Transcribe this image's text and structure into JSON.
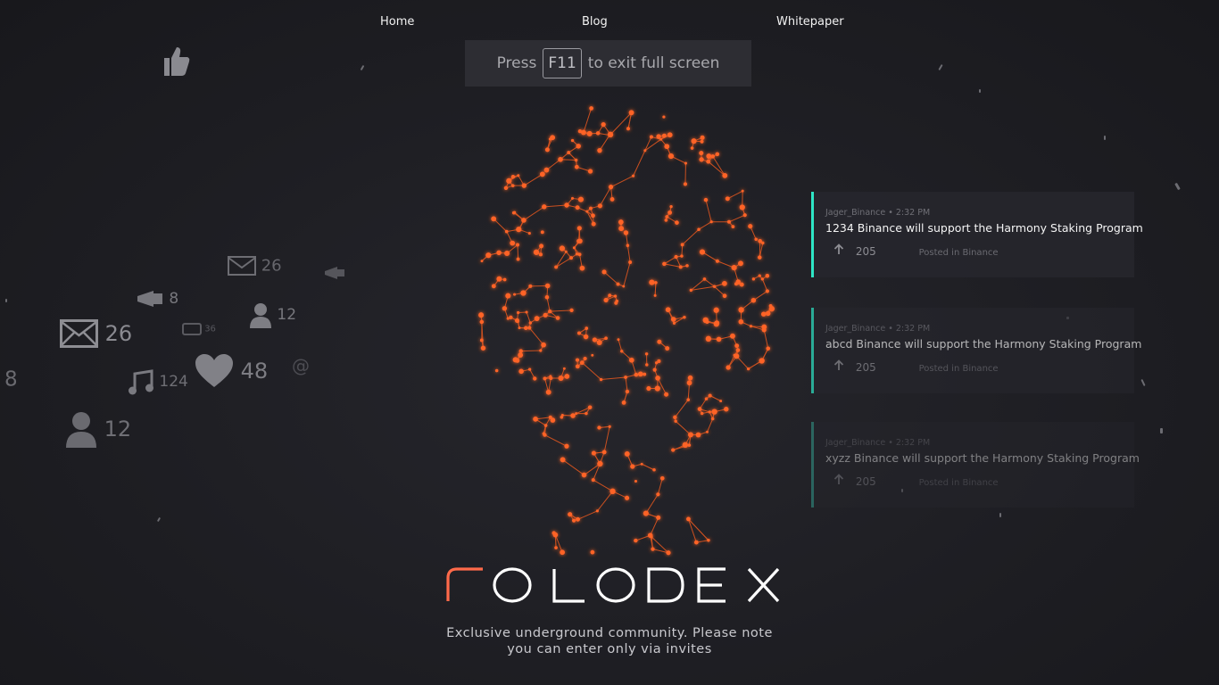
{
  "nav": {
    "home": "Home",
    "blog": "Blog",
    "whitepaper": "Whitepaper"
  },
  "fullscreen_notice": {
    "before": "Press",
    "key": "F11",
    "after": "to exit full screen"
  },
  "social_icons": [
    {
      "icon": "mail-icon",
      "count": "26"
    },
    {
      "icon": "megaphone-icon",
      "count": "8"
    },
    {
      "icon": "user-icon",
      "count": "12"
    },
    {
      "icon": "mail-icon",
      "count": "26"
    },
    {
      "icon": "chat-icon",
      "count": "36"
    },
    {
      "icon": "music-icon",
      "count": "124"
    },
    {
      "icon": "heart-icon",
      "count": "48"
    },
    {
      "icon": "at-icon",
      "count": ""
    },
    {
      "icon": "user-icon",
      "count": "12"
    },
    {
      "icon": "thumb-icon",
      "count": ""
    },
    {
      "icon": "",
      "count": "8"
    }
  ],
  "feed": [
    {
      "author": "Jager_Binance • 2:32 PM",
      "title": "1234 Binance will support the Harmony Staking Program",
      "votes": "205",
      "posted": "Posted in Binance"
    },
    {
      "author": "Jager_Binance • 2:32 PM",
      "title": "abcd Binance will support the Harmony Staking Program",
      "votes": "205",
      "posted": "Posted in Binance"
    },
    {
      "author": "Jager_Binance • 2:32 PM",
      "title": "xyzz Binance will support the Harmony Staking Program",
      "votes": "205",
      "posted": "Posted in Binance"
    }
  ],
  "brand": "rolodex",
  "tagline_line1": "Exclusive underground community. Please note",
  "tagline_line2": "you can enter only via invites",
  "colors": {
    "accent": "#2ee6c6",
    "face_glow": "#ff5a1f",
    "background": "#1f1f24"
  }
}
